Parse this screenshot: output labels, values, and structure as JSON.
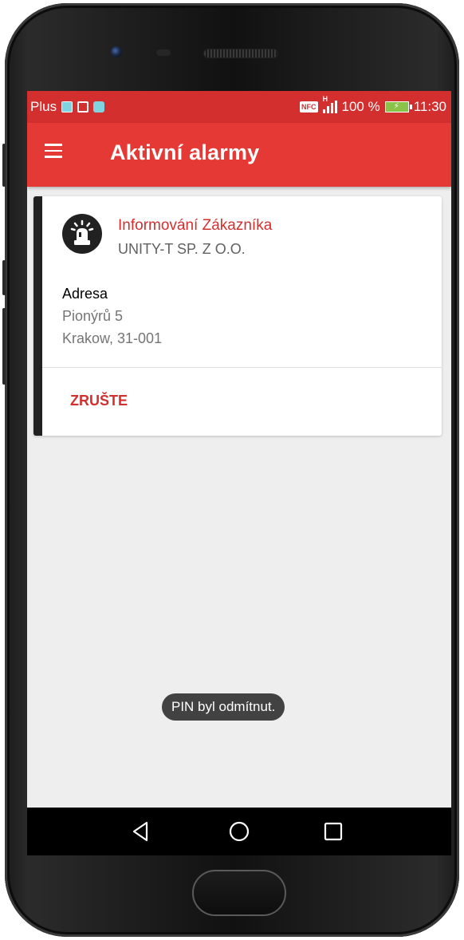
{
  "status_bar": {
    "carrier": "Plus",
    "battery": "100 %",
    "time": "11:30",
    "network_type": "H",
    "nfc_label": "NFC"
  },
  "app_bar": {
    "title": "Aktivní alarmy"
  },
  "alarm_card": {
    "title": "Informování Zákazníka",
    "subtitle": "UNITY-T SP. Z O.O.",
    "address_heading": "Adresa",
    "address_lines": [
      "Pionýrů 5",
      "Krakow, 31-001"
    ],
    "action_label": "ZRUŠTE",
    "icon": "siren-icon"
  },
  "toast": {
    "message": "PIN byl odmítnut."
  },
  "colors": {
    "status_bar": "#d32f2f",
    "app_bar": "#e53935",
    "accent_text": "#d32f2f",
    "card_accent": "#212121",
    "screen_background": "#eeeeee"
  }
}
